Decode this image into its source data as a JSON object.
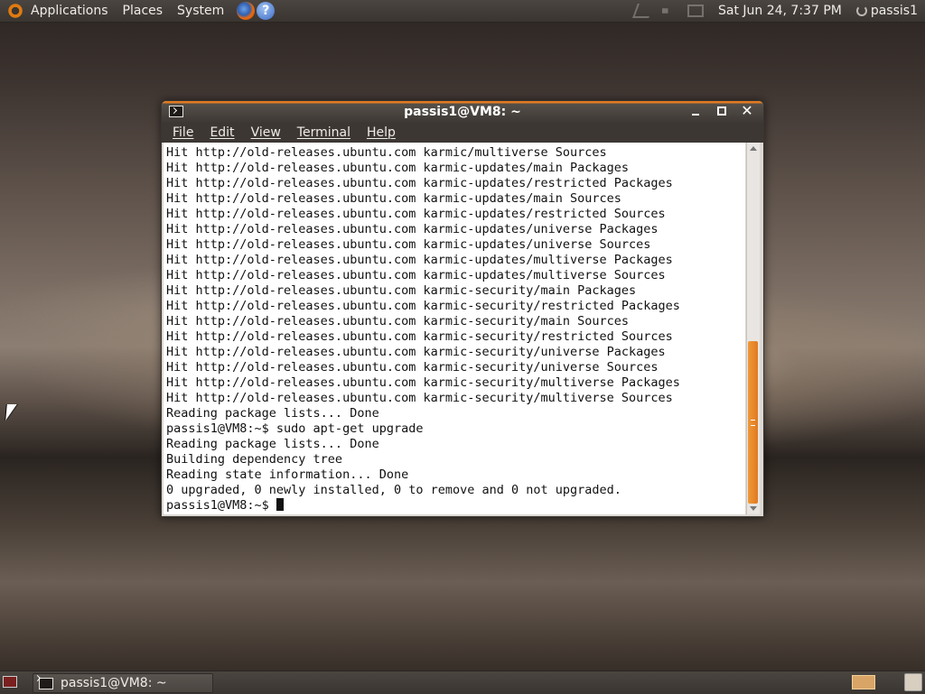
{
  "top_panel": {
    "menus": [
      "Applications",
      "Places",
      "System"
    ],
    "clock": "Sat Jun 24,  7:37 PM",
    "user": "passis1"
  },
  "window": {
    "title": "passis1@VM8: ~",
    "menu": [
      "File",
      "Edit",
      "View",
      "Terminal",
      "Help"
    ],
    "scroll_position": 0.48
  },
  "terminal": {
    "lines": [
      "Hit http://old-releases.ubuntu.com karmic/multiverse Sources",
      "Hit http://old-releases.ubuntu.com karmic-updates/main Packages",
      "Hit http://old-releases.ubuntu.com karmic-updates/restricted Packages",
      "Hit http://old-releases.ubuntu.com karmic-updates/main Sources",
      "Hit http://old-releases.ubuntu.com karmic-updates/restricted Sources",
      "Hit http://old-releases.ubuntu.com karmic-updates/universe Packages",
      "Hit http://old-releases.ubuntu.com karmic-updates/universe Sources",
      "Hit http://old-releases.ubuntu.com karmic-updates/multiverse Packages",
      "Hit http://old-releases.ubuntu.com karmic-updates/multiverse Sources",
      "Hit http://old-releases.ubuntu.com karmic-security/main Packages",
      "Hit http://old-releases.ubuntu.com karmic-security/restricted Packages",
      "Hit http://old-releases.ubuntu.com karmic-security/main Sources",
      "Hit http://old-releases.ubuntu.com karmic-security/restricted Sources",
      "Hit http://old-releases.ubuntu.com karmic-security/universe Packages",
      "Hit http://old-releases.ubuntu.com karmic-security/universe Sources",
      "Hit http://old-releases.ubuntu.com karmic-security/multiverse Packages",
      "Hit http://old-releases.ubuntu.com karmic-security/multiverse Sources",
      "Reading package lists... Done",
      "passis1@VM8:~$ sudo apt-get upgrade",
      "Reading package lists... Done",
      "Building dependency tree",
      "Reading state information... Done",
      "0 upgraded, 0 newly installed, 0 to remove and 0 not upgraded."
    ],
    "prompt": "passis1@VM8:~$ "
  },
  "bottom_panel": {
    "task_label": "passis1@VM8: ~"
  }
}
